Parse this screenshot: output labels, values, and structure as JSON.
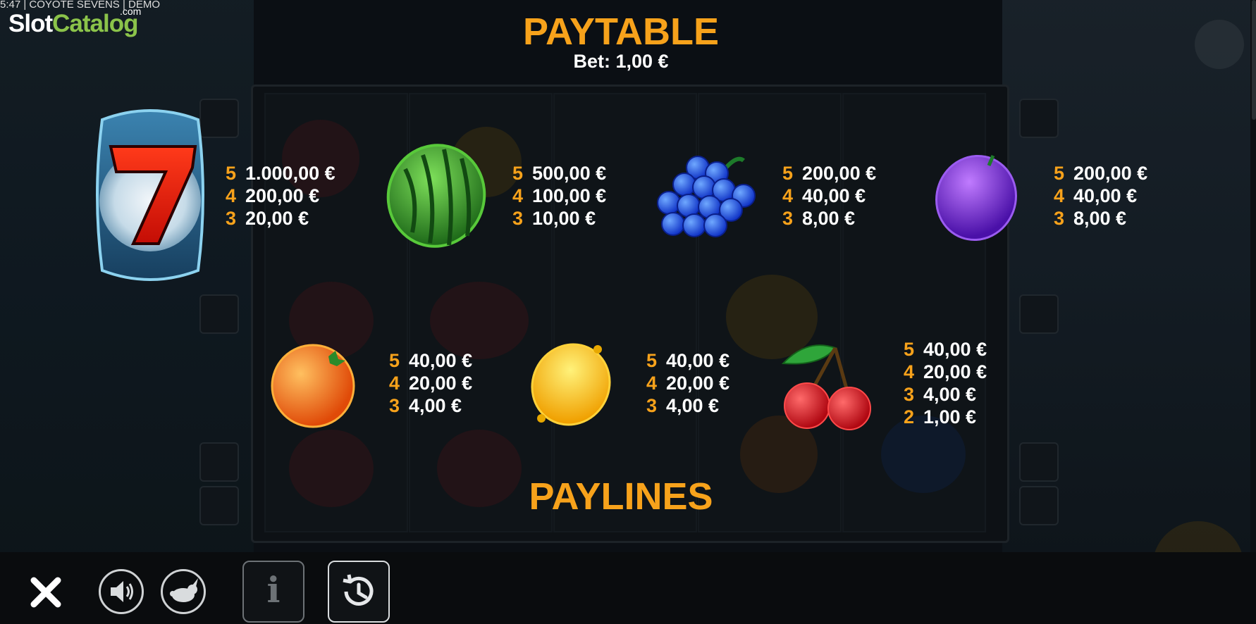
{
  "logo": {
    "top_text": "5:47 | COYOTE SEVENS | DEMO",
    "slot": "Slot",
    "catalog": "Catalog",
    "com": ".com"
  },
  "paytable": {
    "title": "PAYTABLE",
    "bet": "Bet: 1,00 €",
    "symbols": [
      {
        "name": "seven",
        "pays": [
          [
            "5",
            "1.000,00 €"
          ],
          [
            "4",
            "200,00 €"
          ],
          [
            "3",
            "20,00 €"
          ]
        ]
      },
      {
        "name": "watermelon",
        "pays": [
          [
            "5",
            "500,00 €"
          ],
          [
            "4",
            "100,00 €"
          ],
          [
            "3",
            "10,00 €"
          ]
        ]
      },
      {
        "name": "grapes",
        "pays": [
          [
            "5",
            "200,00 €"
          ],
          [
            "4",
            "40,00 €"
          ],
          [
            "3",
            "8,00 €"
          ]
        ]
      },
      {
        "name": "plum",
        "pays": [
          [
            "5",
            "200,00 €"
          ],
          [
            "4",
            "40,00 €"
          ],
          [
            "3",
            "8,00 €"
          ]
        ]
      },
      {
        "name": "orange",
        "pays": [
          [
            "5",
            "40,00 €"
          ],
          [
            "4",
            "20,00 €"
          ],
          [
            "3",
            "4,00 €"
          ]
        ]
      },
      {
        "name": "lemon",
        "pays": [
          [
            "5",
            "40,00 €"
          ],
          [
            "4",
            "20,00 €"
          ],
          [
            "3",
            "4,00 €"
          ]
        ]
      },
      {
        "name": "cherry",
        "pays": [
          [
            "5",
            "40,00 €"
          ],
          [
            "4",
            "20,00 €"
          ],
          [
            "3",
            "4,00 €"
          ],
          [
            "2",
            "1,00 €"
          ]
        ]
      }
    ]
  },
  "paylines": {
    "title": "PAYLINES"
  },
  "bottom_bar": {
    "icons": [
      "close-icon",
      "sound-icon",
      "turbo-rabbit-icon",
      "info-icon",
      "history-icon"
    ],
    "info_glyph": "i"
  },
  "colors": {
    "accent": "#f7a21b",
    "text": "#ffffff",
    "background": "#0b0f14"
  }
}
